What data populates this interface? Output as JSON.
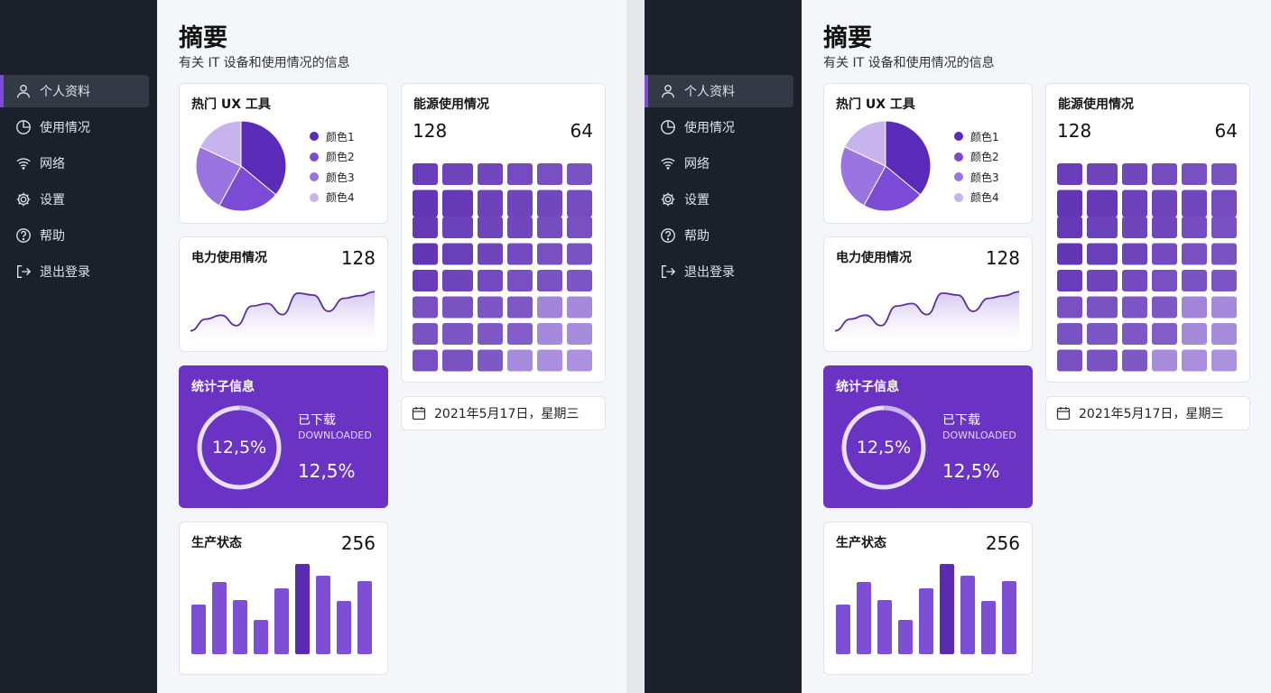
{
  "sidebar": {
    "items": [
      {
        "label": "个人资料",
        "icon": "user-icon",
        "active": true
      },
      {
        "label": "使用情况",
        "icon": "pie-chart-icon",
        "active": false
      },
      {
        "label": "网络",
        "icon": "wifi-icon",
        "active": false
      },
      {
        "label": "设置",
        "icon": "gear-icon",
        "active": false
      },
      {
        "label": "帮助",
        "icon": "help-circle-icon",
        "active": false
      },
      {
        "label": "退出登录",
        "icon": "logout-icon",
        "active": false
      }
    ]
  },
  "header": {
    "title": "摘要",
    "subtitle": "有关 IT 设备和使用情况的信息"
  },
  "colors": {
    "accent": "#6a33c4",
    "sidebar_bg": "#1b202b",
    "sidebar_active": "#333945",
    "pie": [
      "#5a2bb8",
      "#7b4bd6",
      "#9a74e0",
      "#c7b4ee"
    ]
  },
  "cards": {
    "ux_tools": {
      "title": "热门 UX 工具",
      "legend": [
        "颜色1",
        "颜色2",
        "颜色3",
        "颜色4"
      ]
    },
    "power": {
      "title": "电力使用情况",
      "value": "128"
    },
    "stats": {
      "title": "统计子信息",
      "ring_value": "12,5%",
      "downloaded_label": "已下载",
      "downloaded_sub": "DOWNLOADED",
      "downloaded_value": "12,5%"
    },
    "production": {
      "title": "生产状态",
      "value": "256"
    },
    "energy": {
      "title": "能源使用情况",
      "left_value": "128",
      "right_value": "64"
    },
    "date": {
      "text": "2021年5月17日，星期三"
    }
  },
  "chart_data": [
    {
      "type": "pie",
      "categories": [
        "颜色1",
        "颜色2",
        "颜色3",
        "颜色4"
      ],
      "values": [
        36,
        22,
        24,
        18
      ]
    },
    {
      "type": "area",
      "x": [
        0,
        1,
        2,
        3,
        4,
        5,
        6,
        7,
        8,
        9,
        10,
        11,
        12
      ],
      "values": [
        20,
        38,
        44,
        28,
        58,
        62,
        45,
        78,
        75,
        50,
        70,
        74,
        80
      ]
    },
    {
      "type": "donut",
      "values": [
        12.5
      ]
    },
    {
      "type": "bar",
      "values": [
        55,
        80,
        60,
        38,
        73,
        100,
        87,
        59,
        81
      ],
      "highlight_index": 5
    },
    {
      "type": "heatmap",
      "rows": 8,
      "cols": 6,
      "values": [
        [
          0.85,
          0.8,
          0.78,
          0.75,
          0.72,
          0.7
        ],
        [
          0.9,
          0.88,
          0.82,
          0.8,
          0.78,
          0.75
        ],
        [
          0.88,
          0.82,
          0.8,
          0.78,
          0.74,
          0.72
        ],
        [
          0.9,
          0.84,
          0.8,
          0.76,
          0.72,
          0.7
        ],
        [
          0.85,
          0.8,
          0.76,
          0.72,
          0.7,
          0.68
        ],
        [
          0.72,
          0.7,
          0.68,
          0.66,
          0.35,
          0.32
        ],
        [
          0.7,
          0.68,
          0.66,
          0.62,
          0.32,
          0.3
        ],
        [
          0.72,
          0.7,
          0.66,
          0.3,
          0.28,
          0.26
        ]
      ]
    }
  ]
}
